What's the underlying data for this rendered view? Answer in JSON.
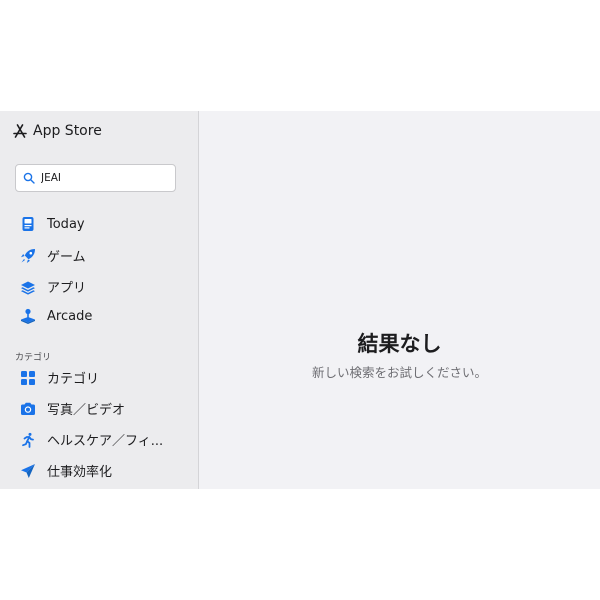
{
  "app": {
    "title": "App Store"
  },
  "search": {
    "value": "JEAI"
  },
  "nav": {
    "items": [
      {
        "label": "Today",
        "icon": "today-icon"
      },
      {
        "label": "ゲーム",
        "icon": "rocket-icon"
      },
      {
        "label": "アプリ",
        "icon": "stack-icon"
      },
      {
        "label": "Arcade",
        "icon": "joystick-icon"
      }
    ],
    "section_label": "カテゴリ",
    "categories": [
      {
        "label": "カテゴリ",
        "icon": "grid-icon"
      },
      {
        "label": "写真／ビデオ",
        "icon": "camera-icon"
      },
      {
        "label": "ヘルスケア／フィ...",
        "icon": "runner-icon"
      },
      {
        "label": "仕事効率化",
        "icon": "paper-plane-icon"
      }
    ]
  },
  "results": {
    "title": "結果なし",
    "subtitle": "新しい検索をお試しください。"
  },
  "colors": {
    "accent": "#1a73e8",
    "sidebar_bg": "#ececee",
    "main_bg": "#f2f2f5"
  }
}
